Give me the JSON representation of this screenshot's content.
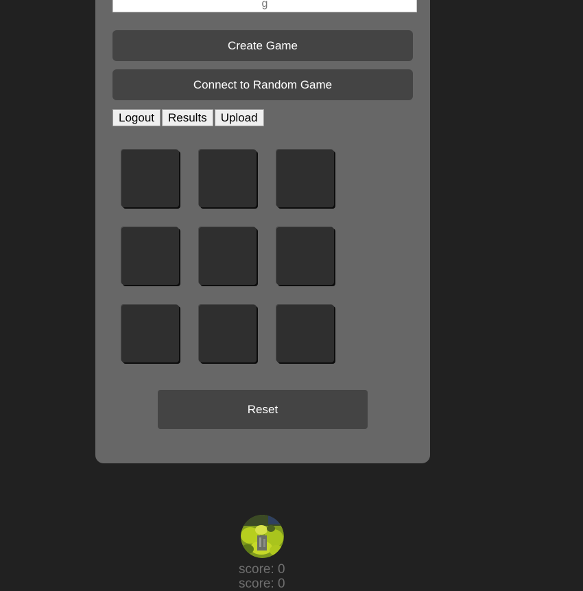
{
  "form": {
    "name_value": "g",
    "create_label": "Create Game",
    "random_label": "Connect to Random Game"
  },
  "nav": {
    "logout_label": "Logout",
    "results_label": "Results",
    "upload_label": "Upload"
  },
  "board": {
    "cells": [
      "",
      "",
      "",
      "",
      "",
      "",
      "",
      "",
      ""
    ]
  },
  "reset_label": "Reset",
  "player": {
    "avatar_icon": "player-avatar-image",
    "score_1": "score: 0",
    "score_2": "score: 0"
  },
  "colors": {
    "background": "#212121",
    "panel": "#676767",
    "button": "#444444",
    "cell": "#2f2f2f"
  }
}
